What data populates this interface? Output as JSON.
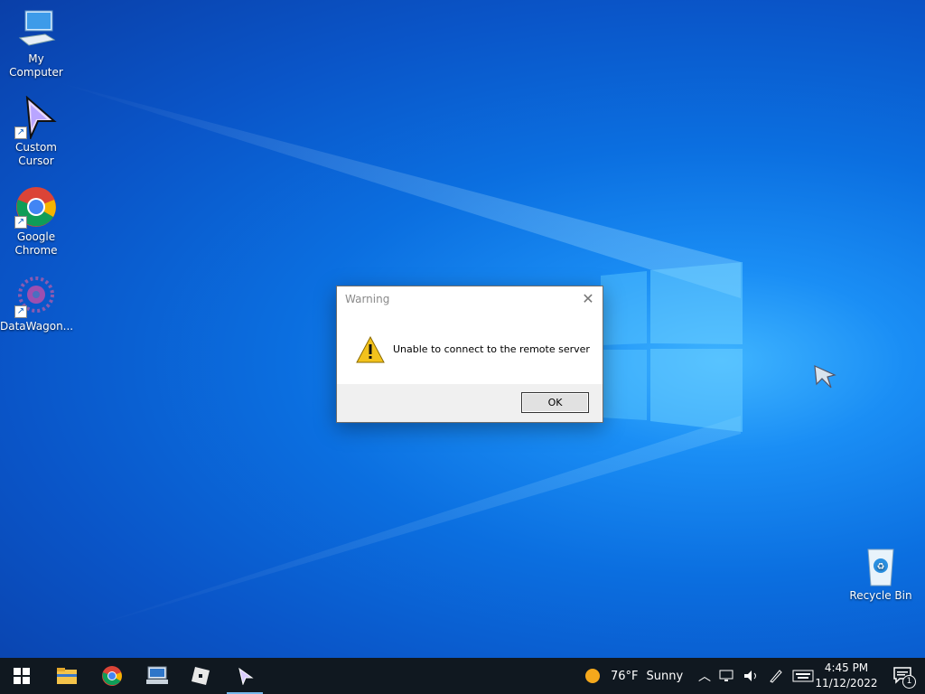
{
  "desktop": {
    "icons": [
      {
        "label": "My Computer"
      },
      {
        "label": "Custom Cursor"
      },
      {
        "label": "Google Chrome"
      },
      {
        "label": "DataWagon..."
      },
      {
        "label": "Recycle Bin"
      }
    ]
  },
  "dialog": {
    "title": "Warning",
    "message": "Unable to connect to the remote server",
    "ok_label": "OK",
    "close_glyph": "✕",
    "icon": "warning-icon"
  },
  "taskbar": {
    "start_icon": "windows-logo-icon",
    "pinned": [
      "file-explorer-icon",
      "chrome-icon",
      "remote-desktop-icon",
      "roblox-icon",
      "custom-cursor-icon"
    ],
    "weather": {
      "temp": "76°F",
      "condition": "Sunny"
    },
    "clock": {
      "time": "4:45 PM",
      "date": "11/12/2022"
    },
    "notification_count": "1"
  },
  "colors": {
    "desktop_blue": "#0b6fe0",
    "taskbar": "#101820",
    "dialog_footer": "#f0f0f0"
  }
}
